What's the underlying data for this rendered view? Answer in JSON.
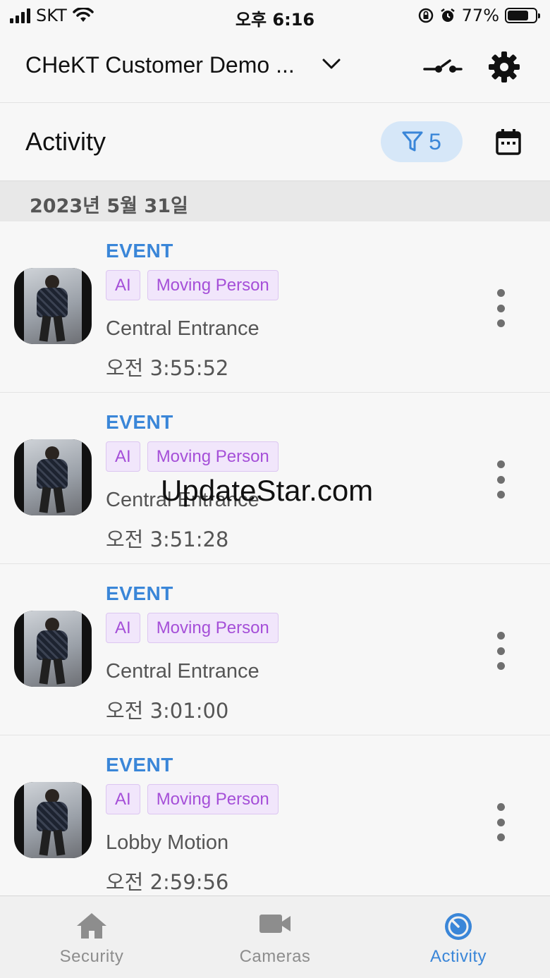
{
  "status_bar": {
    "carrier": "SKT",
    "time": "오후 6:16",
    "battery_percent": "77%",
    "battery_level": 0.77
  },
  "header": {
    "site_title": "CHeKT Customer Demo ...",
    "icons": [
      "chevron-down-icon",
      "link-icon",
      "gear-icon"
    ]
  },
  "activity_bar": {
    "title": "Activity",
    "filter_count": "5",
    "icons": [
      "filter-icon",
      "calendar-icon"
    ]
  },
  "date_header": "2023년 5월 31일",
  "events": [
    {
      "type": "EVENT",
      "tags": [
        "AI",
        "Moving Person"
      ],
      "camera": "Central Entrance",
      "time": "오전 3:55:52"
    },
    {
      "type": "EVENT",
      "tags": [
        "AI",
        "Moving Person"
      ],
      "camera": "Central Entrance",
      "time": "오전 3:51:28"
    },
    {
      "type": "EVENT",
      "tags": [
        "AI",
        "Moving Person"
      ],
      "camera": "Central Entrance",
      "time": "오전 3:01:00"
    },
    {
      "type": "EVENT",
      "tags": [
        "AI",
        "Moving Person"
      ],
      "camera": "Lobby Motion",
      "time": "오전 2:59:56"
    }
  ],
  "watermark": "UpdateStar.com",
  "tab_bar": {
    "tabs": [
      {
        "label": "Security",
        "icon": "home-icon",
        "active": false
      },
      {
        "label": "Cameras",
        "icon": "video-camera-icon",
        "active": false
      },
      {
        "label": "Activity",
        "icon": "activity-timer-icon",
        "active": true
      }
    ]
  },
  "colors": {
    "accent": "#3a86d8",
    "tag_text": "#a54fd8",
    "tag_background": "#f1e6fb",
    "filter_pill": "#d6e7f8"
  }
}
